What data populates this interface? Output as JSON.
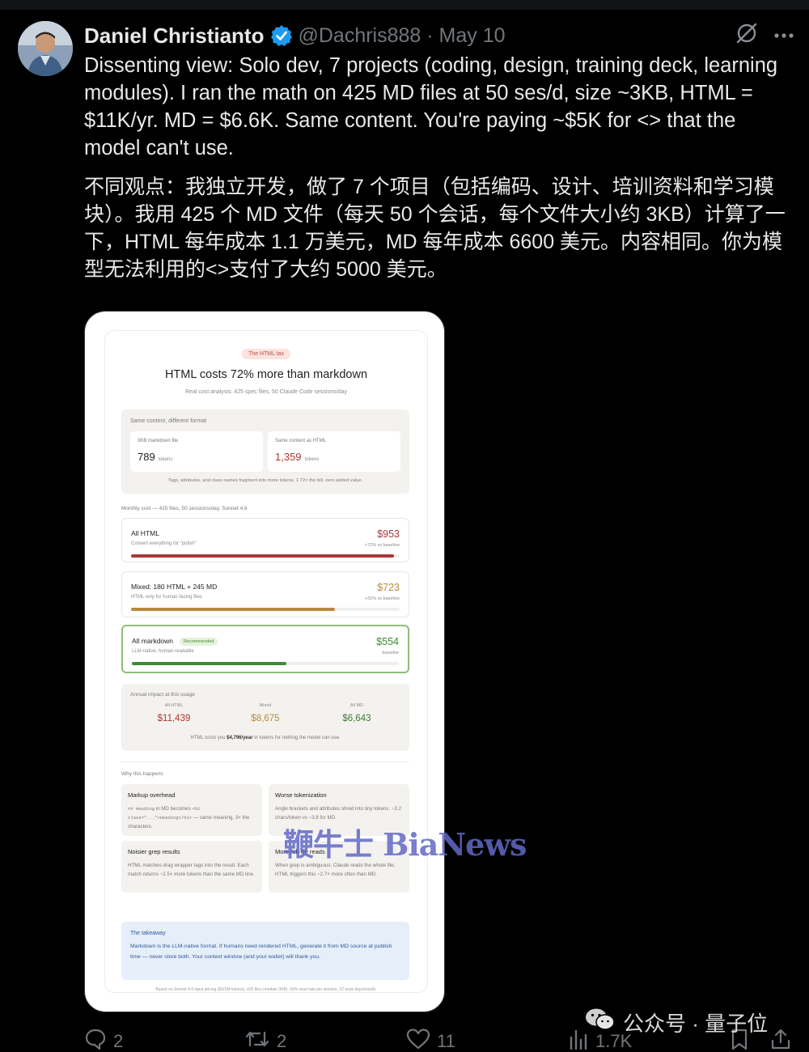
{
  "tweet": {
    "author_name": "Daniel Christianto",
    "handle_date": "@Dachris888 · May 10",
    "text_en": "Dissenting view:  Solo dev, 7 projects (coding, design, training deck, learning modules).  I ran the math on 425 MD files at 50 ses/d, size ~3KB, HTML = $11K/yr. MD = $6.6K. Same content. You're paying ~$5K for <> that the model can't use.",
    "text_zh": "不同观点：我独立开发，做了 7 个项目（包括编码、设计、培训资料和学习模块）。我用 425 个 MD 文件（每天 50 个会话，每个文件大小约 3KB）计算了一下，HTML 每年成本 1.1 万美元，MD 每年成本 6600 美元。内容相同。你为模型无法利用的<>支付了大约 5000 美元。"
  },
  "card": {
    "pill": "The HTML tax",
    "title": "HTML costs 72% more than markdown",
    "subtitle": "Real cost analysis: 425 spec files, 50 Claude Code sessions/day",
    "compare": {
      "heading": "Same content, different format",
      "md_label": "3KB markdown file",
      "md_tokens": "789",
      "html_label": "Same content as HTML",
      "html_tokens": "1,359",
      "unit": "tokens",
      "note": "Tags, attributes, and class names fragment into more tokens. 1.72× the bill, zero added value."
    },
    "monthly_heading": "Monthly cost — 425 files, 50 sessions/day, Sonnet 4.6",
    "rows": [
      {
        "title": "All HTML",
        "sub": "Convert everything for \"polish\"",
        "price": "$953",
        "note": "+72% vs baseline",
        "fill": 0.98,
        "color": "#a7393a",
        "badge": ""
      },
      {
        "title": "Mixed: 180 HTML + 245 MD",
        "sub": "HTML only for human-facing files",
        "price": "$723",
        "note": "+31% vs baseline",
        "fill": 0.76,
        "color": "#b88a3c",
        "badge": ""
      },
      {
        "title": "All markdown",
        "sub": "LLM-native, human-readable",
        "price": "$554",
        "note": "baseline",
        "fill": 0.58,
        "color": "#3d8a33",
        "badge": "Recommended"
      }
    ],
    "annual": {
      "heading": "Annual impact at this usage",
      "cols": [
        {
          "label": "All HTML",
          "value": "$11,439",
          "color": "#b0362f"
        },
        {
          "label": "Mixed",
          "value": "$8,675",
          "color": "#b88a3c"
        },
        {
          "label": "All MD",
          "value": "$6,643",
          "color": "#3d7a33"
        }
      ],
      "note_pre": "HTML costs you ",
      "note_bold": "$4,796/year",
      "note_post": " in tokens for nothing the model can use."
    },
    "why_heading": "Why this happens",
    "why": [
      {
        "title": "Markup overhead",
        "t1": "## Heading",
        "t2": " in MD becomes ",
        "t3": "<h2 class=\"...\">Heading</h2>",
        "t4": " — same meaning, 3× the characters."
      },
      {
        "title": "Worse tokenization",
        "text": "Angle brackets and attributes shred into tiny tokens. ~3.2 chars/token vs ~3.8 for MD."
      },
      {
        "title": "Noisier grep results",
        "text": "HTML matches drag wrapper tags into the result. Each match returns ~2.5× more tokens than the same MD line."
      },
      {
        "title": "More full-file reads",
        "text": "When grep is ambiguous, Claude reads the whole file. HTML triggers this ~2.7× more often than MD."
      }
    ],
    "takeaway": {
      "heading": "The takeaway",
      "text": "Markdown is the LLM-native format. If humans need rendered HTML, generate it from MD source at publish time — never store both. Your context window (and your wallet) will thank you."
    },
    "footnote": "Based on Sonnet 4.6 input pricing ($3/1M tokens), 425 files (median 3KB), 50% read rate per session, 22 work days/month."
  },
  "watermark": "鞭牛士 BiaNews",
  "actions": {
    "replies": "2",
    "reposts": "2",
    "likes": "11",
    "views": "1.7K"
  },
  "wechat": "公众号 · 量子位",
  "colors": {
    "background": "#000000",
    "text": "#e7e9ea",
    "muted": "#71767b",
    "verified": "#1d9bf0"
  }
}
